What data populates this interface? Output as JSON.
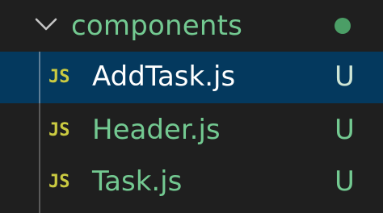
{
  "explorer": {
    "folder": {
      "name": "components",
      "chevron_icon": "chevron-down-icon",
      "status_dot_color": "#4b9e66"
    },
    "files": [
      {
        "icon_text": "JS",
        "icon": "javascript-file-icon",
        "name": "AddTask.js",
        "status": "U",
        "selected": true
      },
      {
        "icon_text": "JS",
        "icon": "javascript-file-icon",
        "name": "Header.js",
        "status": "U",
        "selected": false
      },
      {
        "icon_text": "JS",
        "icon": "javascript-file-icon",
        "name": "Task.js",
        "status": "U",
        "selected": false
      }
    ],
    "colors": {
      "background": "#1f1f1f",
      "selected_row": "#04395e",
      "untracked_text": "#73c991",
      "js_icon": "#cbcb41"
    }
  }
}
